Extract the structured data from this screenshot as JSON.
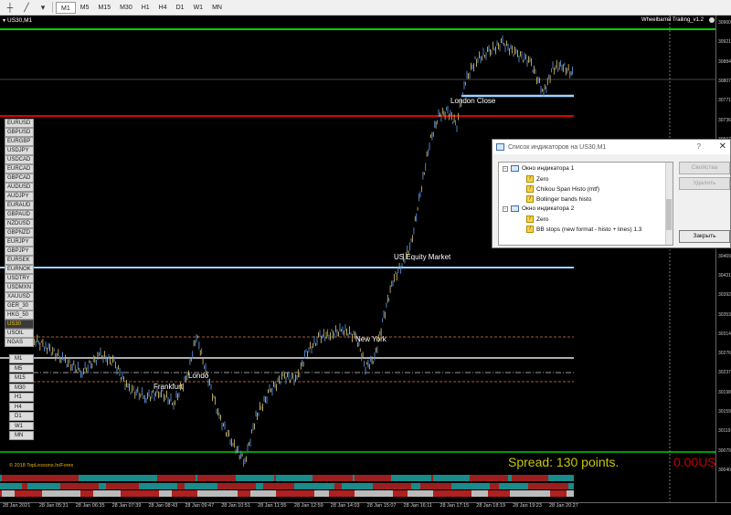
{
  "toolbar": {
    "timeframes": [
      "M1",
      "M5",
      "M15",
      "M30",
      "H1",
      "H4",
      "D1",
      "W1",
      "MN"
    ],
    "active_timeframe": "M1"
  },
  "chart": {
    "title": "US30,M1",
    "expert_name": "Wheelbarrel Trailing_v1.2",
    "copyright": "© 2018 TopLessons.In/Forex",
    "spread_label": "Spread: 130 points.",
    "spread_value": "0.00US",
    "sessions": {
      "london_close": "London Close",
      "us_equity": "US Equity Market",
      "new_york": "New York",
      "london": "Londo",
      "frankfurt": "Frankfurt"
    },
    "price_labels": [
      "30960",
      "30921",
      "30884",
      "30807",
      "30771",
      "30736",
      "30697",
      "30659",
      "30620",
      "30580",
      "30546",
      "30508",
      "30469",
      "30431",
      "30392",
      "30353",
      "30314",
      "30276",
      "30237",
      "30198",
      "30159",
      "30119",
      "30079",
      "30040"
    ],
    "time_labels": [
      "28 Jan 2021",
      "28 Jan 05:31",
      "28 Jan 06:35",
      "28 Jan 07:39",
      "28 Jan 08:43",
      "28 Jan 09:47",
      "28 Jan 10:51",
      "28 Jan 11:55",
      "28 Jan 12:59",
      "28 Jan 14:03",
      "28 Jan 15:07",
      "28 Jan 16:11",
      "28 Jan 17:15",
      "28 Jan 18:19",
      "28 Jan 19:23",
      "28 Jan 20:27"
    ],
    "colors": {
      "green_line": "#00d000",
      "red_line": "#e00000",
      "level_line": "#9fd4ff",
      "candles_up": "#5b8fd6",
      "candles_down": "#c8b25a"
    }
  },
  "symbols": [
    "EURUSD",
    "GBPUSD",
    "EURGBP",
    "USDJPY",
    "USDCAD",
    "EURCAD",
    "GBPCAD",
    "AUDUSD",
    "AUDJPY",
    "EURAUD",
    "GBPAUD",
    "NZDUSD",
    "GBPNZD",
    "EURJPY",
    "GBPJPY",
    "EURSEK",
    "EURNOK",
    "USDTRY",
    "USDMXN",
    "XAUUSD",
    "GER_30",
    "HKG_50",
    "US30",
    "USOIL",
    "NGAS"
  ],
  "selected_symbol": "US30",
  "timeframe_buttons": [
    "M1",
    "M5",
    "M15",
    "M30",
    "H1",
    "H4",
    "D1",
    "W1",
    "MN"
  ],
  "dialog": {
    "title": "Список индикаторов на US30,M1",
    "help": "?",
    "close": "✕",
    "windows": [
      {
        "label": "Окно индикатора 1",
        "items": [
          "Zero",
          "Chikou Span Histo (mtf)",
          "Bollinger bands histo"
        ]
      },
      {
        "label": "Окно индикатора 2",
        "items": [
          "Zero",
          "BB stops (new format - histo + lines) 1.3"
        ]
      }
    ],
    "buttons": {
      "properties": "Свойства",
      "delete": "Удалить",
      "close": "Закрыть"
    }
  }
}
